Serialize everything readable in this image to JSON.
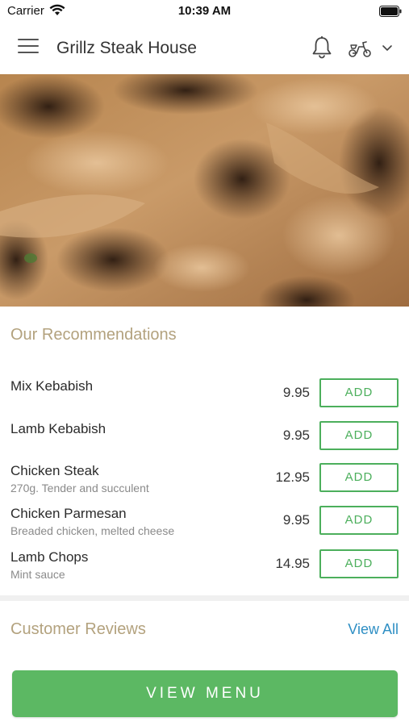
{
  "status_bar": {
    "carrier": "Carrier",
    "time": "10:39 AM"
  },
  "header": {
    "title": "Grillz Steak House",
    "icons": [
      "menu-icon",
      "bell-icon",
      "scooter-icon",
      "chevron-down-icon"
    ]
  },
  "hero": {
    "image": "grilled-meat-photo"
  },
  "recommendations": {
    "title": "Our Recommendations",
    "add_label": "ADD",
    "items": [
      {
        "name": "Mix Kebabish",
        "description": "",
        "price": "9.95"
      },
      {
        "name": "Lamb Kebabish",
        "description": "",
        "price": "9.95"
      },
      {
        "name": "Chicken Steak",
        "description": "270g. Tender and succulent",
        "price": "12.95"
      },
      {
        "name": "Chicken Parmesan",
        "description": "Breaded chicken, melted cheese",
        "price": "9.95"
      },
      {
        "name": "Lamb Chops",
        "description": "Mint sauce",
        "price": "14.95"
      }
    ]
  },
  "reviews": {
    "title": "Customer Reviews",
    "view_all_label": "View All"
  },
  "footer": {
    "view_menu_label": "VIEW MENU"
  },
  "colors": {
    "accent_green": "#5cb863",
    "section_title": "#b3a27e",
    "link_blue": "#2f8fc4"
  }
}
